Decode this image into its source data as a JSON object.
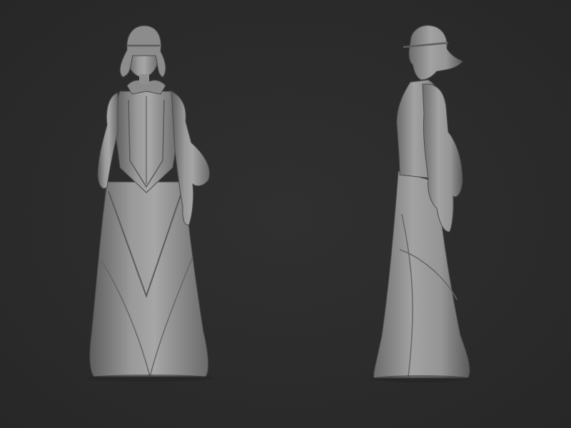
{
  "scene": {
    "background_color": "#2c2c2c",
    "clay_color": "#8e8e8e",
    "figures": [
      {
        "view": "front"
      },
      {
        "view": "side"
      }
    ]
  }
}
